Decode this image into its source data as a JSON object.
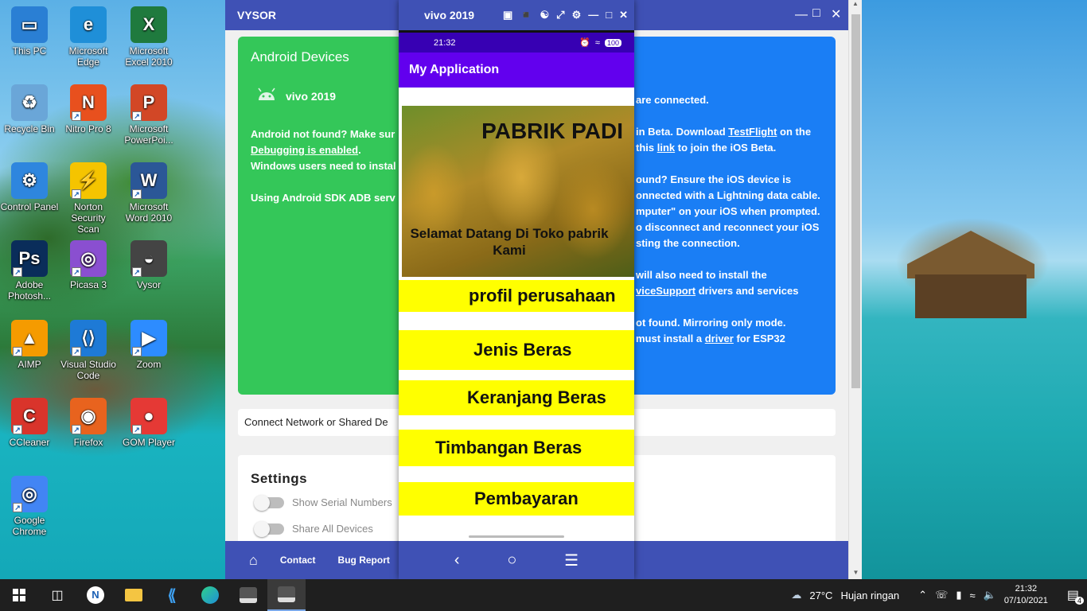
{
  "desktop": {
    "icons": [
      {
        "label": "This PC",
        "icon": "computer-icon",
        "color": "#2a7fd4"
      },
      {
        "label": "Microsoft Edge",
        "icon": "edge-icon",
        "color": "#1f8fd8"
      },
      {
        "label": "Microsoft Excel 2010",
        "icon": "excel-icon",
        "color": "#1f7a3e"
      },
      {
        "label": "Recycle Bin",
        "icon": "recycle-bin-icon",
        "color": "#6aa6d8"
      },
      {
        "label": "Nitro Pro 8",
        "icon": "nitro-icon",
        "color": "#e8501e"
      },
      {
        "label": "Microsoft PowerPoi...",
        "icon": "powerpoint-icon",
        "color": "#d24726"
      },
      {
        "label": "Control Panel",
        "icon": "control-panel-icon",
        "color": "#2e86de"
      },
      {
        "label": "Norton Security Scan",
        "icon": "norton-icon",
        "color": "#f5c400"
      },
      {
        "label": "Microsoft Word 2010",
        "icon": "word-icon",
        "color": "#2b5797"
      },
      {
        "label": "Adobe Photosh...",
        "icon": "photoshop-icon",
        "color": "#0a2d5a"
      },
      {
        "label": "Picasa 3",
        "icon": "picasa-icon",
        "color": "#8a4fd0"
      },
      {
        "label": "Vysor",
        "icon": "vysor-icon",
        "color": "#444444"
      },
      {
        "label": "AIMP",
        "icon": "aimp-icon",
        "color": "#f59b00"
      },
      {
        "label": "Visual Studio Code",
        "icon": "vscode-icon",
        "color": "#1e7ad6"
      },
      {
        "label": "Zoom",
        "icon": "zoom-icon",
        "color": "#2d8cff"
      },
      {
        "label": "CCleaner",
        "icon": "ccleaner-icon",
        "color": "#d9342b"
      },
      {
        "label": "Firefox",
        "icon": "firefox-icon",
        "color": "#e8631e"
      },
      {
        "label": "GOM Player",
        "icon": "gom-player-icon",
        "color": "#e53935"
      },
      {
        "label": "Google Chrome",
        "icon": "chrome-icon",
        "color": "#4285f4"
      }
    ]
  },
  "vysor": {
    "title": "VYSOR",
    "android": {
      "header": "Android Devices",
      "device_name": "vivo 2019",
      "help_1a": "Android not found? Make sur",
      "help_1b": "Debugging is enabled",
      "help_1c": ".",
      "help_2": "Windows users need to instal",
      "help_3": "Using Android SDK ADB serv"
    },
    "ios": {
      "line_connected": "are connected.",
      "beta_a": "in Beta. Download ",
      "beta_link": "TestFlight",
      "beta_b": " on the",
      "beta_c": " this ",
      "beta_link2": "link",
      "beta_d": " to join the iOS Beta.",
      "notfound_1": "ound? Ensure the iOS device is",
      "notfound_2": "onnected with a Lightning data cable.",
      "notfound_3": "mputer\" on your iOS when prompted.",
      "notfound_4": "o disconnect and reconnect your iOS",
      "notfound_5": "sting the connection.",
      "drivers_1": "will also need to install the",
      "drivers_link": "viceSupport",
      "drivers_2": " drivers and services",
      "mirror_1": "ot found. Mirroring only mode.",
      "esp_a": "must install a ",
      "esp_link": "driver",
      "esp_b": " for ESP32"
    },
    "connect_label": "Connect Network or Shared De",
    "settings": {
      "title": "Settings",
      "show_serial": "Show Serial Numbers",
      "share_all": "Share All Devices"
    },
    "footer": {
      "contact": "Contact",
      "bug_report": "Bug Report"
    }
  },
  "phone": {
    "title": "vivo 2019",
    "status_time": "21:32",
    "battery": "100",
    "app_title": "My Application",
    "banner_title": "PABRIK PADI",
    "banner_sub": "Selamat Datang Di Toko pabrik Kami",
    "menu": [
      "profil perusahaan",
      "Jenis Beras",
      "Keranjang Beras",
      "Timbangan Beras",
      "Pembayaran"
    ]
  },
  "taskbar": {
    "weather_temp": "27°C",
    "weather_desc": "Hujan ringan",
    "time": "21:32",
    "date": "07/10/2021",
    "notifications": "4"
  }
}
